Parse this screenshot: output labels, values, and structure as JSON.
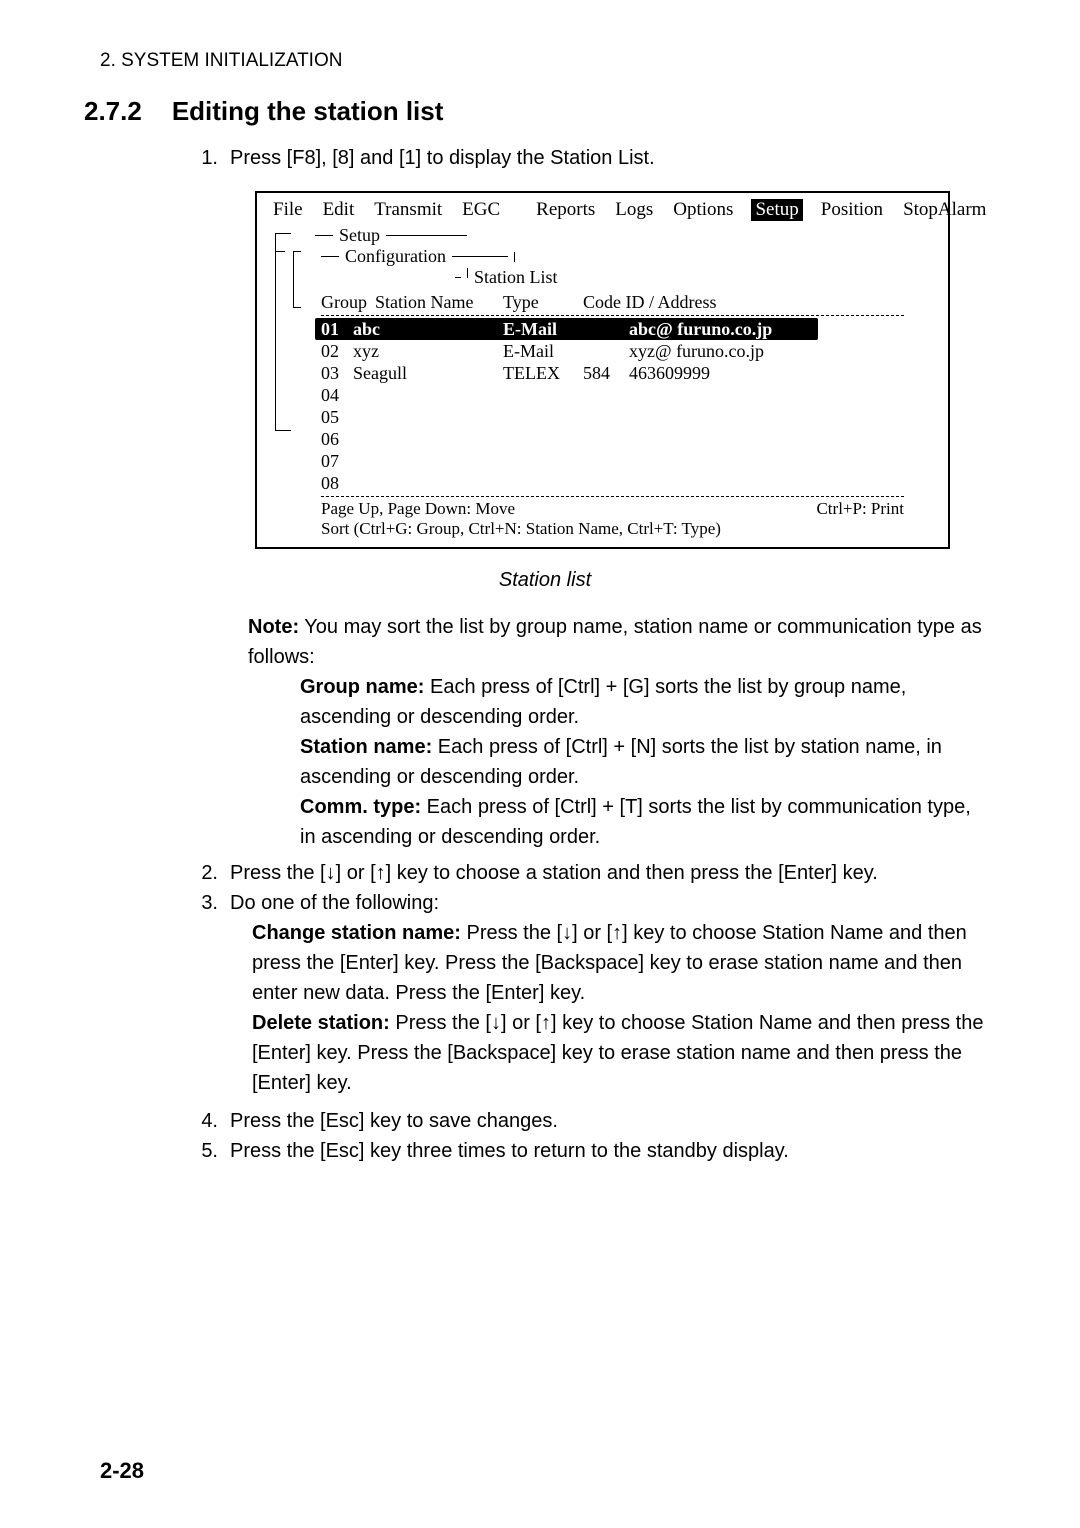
{
  "header": "2. SYSTEM INITIALIZATION",
  "section_num": "2.7.2",
  "section_title": "Editing the station list",
  "step1_num": "1.",
  "step1": "Press [F8], [8] and [1] to display the Station List.",
  "menu": {
    "file": "File",
    "edit": "Edit",
    "transmit": "Transmit",
    "egc": "EGC",
    "reports": "Reports",
    "logs": "Logs",
    "options": "Options",
    "setup": "Setup",
    "position": "Position",
    "stopalarm": "StopAlarm"
  },
  "fig": {
    "setup_label": "Setup",
    "config_label": "Configuration",
    "sl_label": "Station List",
    "h_group": "Group",
    "h_station": "Station Name",
    "h_type": "Type",
    "h_code": "Code ID / Address",
    "rows": [
      {
        "n": "01",
        "name": "abc",
        "type": "E-Mail",
        "code": "",
        "addr": "abc@ furuno.co.jp"
      },
      {
        "n": "02",
        "name": "xyz",
        "type": "E-Mail",
        "code": "",
        "addr": "xyz@ furuno.co.jp"
      },
      {
        "n": "03",
        "name": "Seagull",
        "type": "TELEX",
        "code": "584",
        "addr": "463609999"
      },
      {
        "n": "04",
        "name": "",
        "type": "",
        "code": "",
        "addr": ""
      },
      {
        "n": "05",
        "name": "",
        "type": "",
        "code": "",
        "addr": ""
      },
      {
        "n": "06",
        "name": "",
        "type": "",
        "code": "",
        "addr": ""
      },
      {
        "n": "07",
        "name": "",
        "type": "",
        "code": "",
        "addr": ""
      },
      {
        "n": "08",
        "name": "",
        "type": "",
        "code": "",
        "addr": ""
      }
    ],
    "foot_left": "Page Up, Page Down: Move",
    "foot_right": "Ctrl+P: Print",
    "foot_sort": "Sort (Ctrl+G: Group, Ctrl+N: Station Name, Ctrl+T: Type)"
  },
  "caption": "Station list",
  "note_label": "Note:",
  "note_intro": " You may sort the list by group name, station name or communication type as follows:",
  "note_g_label": "Group name:",
  "note_g": " Each press of [Ctrl] + [G] sorts the list by group name, ascending or descending order.",
  "note_s_label": "Station name:",
  "note_s": " Each press of [Ctrl] + [N] sorts the list by station name, in ascending or descending order.",
  "note_c_label": "Comm. type:",
  "note_c": " Each press of [Ctrl] + [T] sorts the list by communication type, in ascending or descending order.",
  "step2_num": "2.",
  "step2a": "Press the [",
  "down": "↓",
  "step2b": "] or [",
  "up": "↑",
  "step2c": "] key to choose a station and then press the [Enter] key.",
  "step3_num": "3.",
  "step3": "Do one of the following:",
  "chg_label": "Change station name:",
  "chg_a": " Press the [",
  "chg_b": "] or [",
  "chg_c": "] key to choose Station Name and then press the [Enter] key. Press the [Backspace] key to erase station name and then enter new data. Press the [Enter] key.",
  "del_label": "Delete station:",
  "del_a": " Press the [",
  "del_b": "] or [",
  "del_c": "] key to choose Station Name and then press the [Enter] key. Press the [Backspace] key to erase station name and then press the [Enter] key.",
  "step4_num": "4.",
  "step4": "Press the [Esc] key to save changes.",
  "step5_num": "5.",
  "step5": "Press the [Esc] key three times to return to the standby display.",
  "page_num": "2-28"
}
